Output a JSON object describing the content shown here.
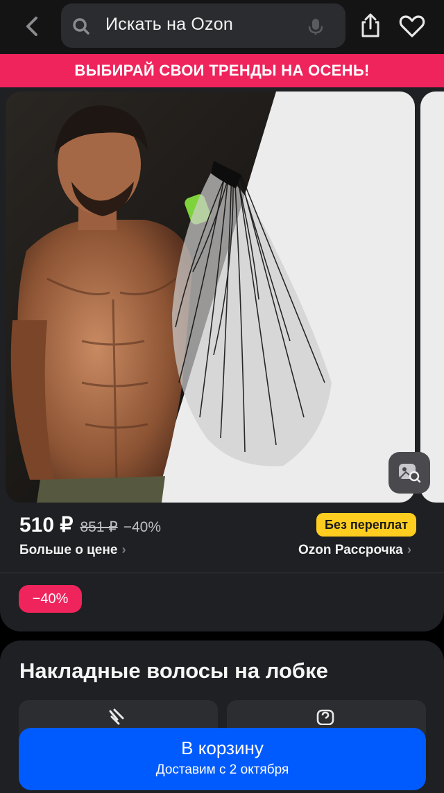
{
  "header": {
    "search_placeholder": "Искать на Ozon",
    "icons": [
      "back-arrow-icon",
      "search-icon",
      "microphone-icon",
      "share-icon",
      "heart-icon"
    ]
  },
  "promo_banner": {
    "text": "ВЫБИРАЙ СВОИ ТРЕНДЫ НА ОСЕНЬ!"
  },
  "price": {
    "current": "510 ₽",
    "old": "851 ₽",
    "discount": "−40%",
    "more_link": "Больше о цене",
    "installment_badge": "Без переплат",
    "installment_link": "Ozon Рассрочка"
  },
  "discount_tag": "−40%",
  "product": {
    "title": "Накладные волосы на лобке"
  },
  "cart": {
    "button_label": "В корзину",
    "delivery": "Доставим с 2 октября"
  },
  "colors": {
    "accent_pink": "#f0245c",
    "ozon_blue": "#005bff",
    "badge_yellow": "#ffcd1f",
    "card_bg": "#1f2023"
  }
}
